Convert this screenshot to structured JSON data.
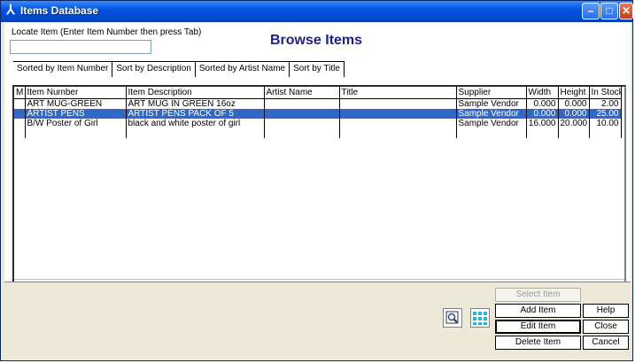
{
  "window": {
    "title": "Items Database",
    "app_icon": "app-logo-icon",
    "controls": [
      "minimize-icon",
      "maximize-icon",
      "close-icon"
    ]
  },
  "locate": {
    "label": "Locate Item (Enter Item Number then press Tab)",
    "value": ""
  },
  "heading": "Browse Items",
  "tabs": [
    {
      "label": "Sorted by Item Number",
      "active": true
    },
    {
      "label": "Sort by Description",
      "active": false
    },
    {
      "label": "Sorted by Artist Name",
      "active": false
    },
    {
      "label": "Sort by Title",
      "active": false
    }
  ],
  "grid": {
    "columns": [
      "M",
      "Item Number",
      "Item Description",
      "Artist Name",
      "Title",
      "Supplier",
      "Width",
      "Height",
      "In Stock"
    ],
    "rows": [
      {
        "m": "",
        "item_number": "ART MUG-GREEN",
        "description": "ART MUG IN GREEN 16oz",
        "artist": "",
        "title": "",
        "supplier": "Sample Vendor",
        "width": "0.000",
        "height": "0.000",
        "in_stock": "2.00",
        "selected": false
      },
      {
        "m": "",
        "item_number": "ARTIST PENS",
        "description": "ARTIST PENS PACK OF 5",
        "artist": "",
        "title": "",
        "supplier": "Sample Vendor",
        "width": "0.000",
        "height": "0.000",
        "in_stock": "25.00",
        "selected": true
      },
      {
        "m": "",
        "item_number": "B/W Poster of Girl",
        "description": "black and white poster of girl",
        "artist": "",
        "title": "",
        "supplier": "Sample Vendor",
        "width": "16.000",
        "height": "20.000",
        "in_stock": "10.00",
        "selected": false
      }
    ],
    "nav_buttons": [
      "|◄",
      "◄◄",
      "◄",
      "?",
      "►",
      "►►",
      "►|"
    ]
  },
  "buttons": {
    "select_item": "Select Item",
    "add_item": "Add Item",
    "edit_item": "Edit Item",
    "delete_item": "Delete Item",
    "help": "Help",
    "close": "Close",
    "cancel": "Cancel"
  },
  "icons": {
    "search": "magnify-icon",
    "grid": "grid-view-icon"
  }
}
